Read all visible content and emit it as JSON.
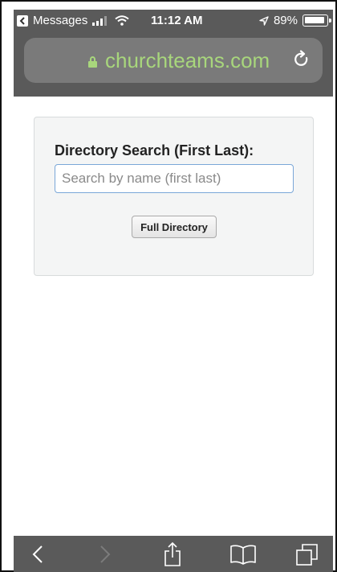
{
  "status_bar": {
    "back_app": "Messages",
    "time": "11:12 AM",
    "battery": "89%"
  },
  "browser": {
    "domain": "churchteams.com"
  },
  "directory": {
    "label": "Directory Search (First Last):",
    "search_placeholder": "Search by name (first last)",
    "search_value": "",
    "full_directory_label": "Full Directory"
  },
  "icons": {
    "back": "chevron-left-icon",
    "forward": "chevron-right-icon",
    "share": "share-icon",
    "bookmarks": "book-icon",
    "tabs": "tabs-icon",
    "reload": "reload-icon",
    "lock": "lock-icon"
  },
  "colors": {
    "chrome": "#5a5a5a",
    "url_field": "#7a7a7a",
    "secure_domain": "#a8d67c"
  }
}
